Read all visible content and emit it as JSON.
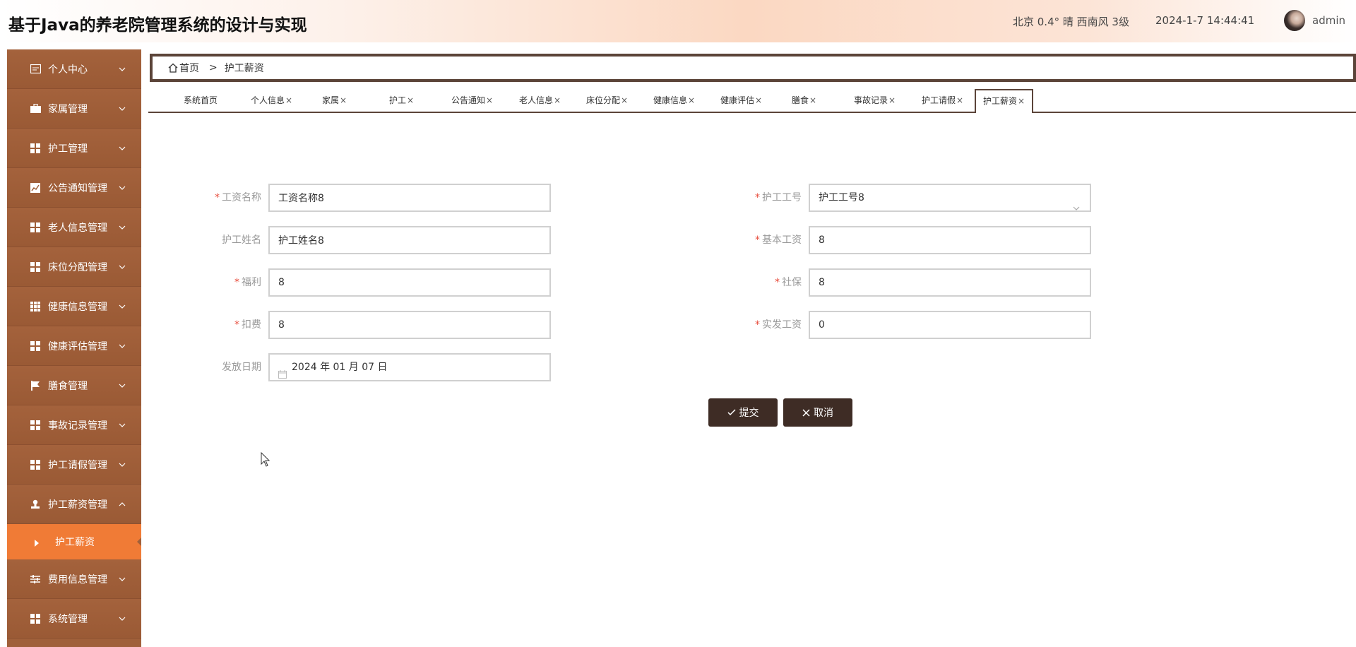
{
  "header": {
    "title": "基于Java的养老院管理系统的设计与实现",
    "weather": "北京  0.4°  晴  西南风  3级",
    "datetime": "2024-1-7 14:44:41",
    "username": "admin"
  },
  "sidebar": {
    "items": [
      {
        "label": "个人中心",
        "icon": "profile-icon"
      },
      {
        "label": "家属管理",
        "icon": "briefcase-icon"
      },
      {
        "label": "护工管理",
        "icon": "grid-icon"
      },
      {
        "label": "公告通知管理",
        "icon": "chart-icon"
      },
      {
        "label": "老人信息管理",
        "icon": "grid-icon"
      },
      {
        "label": "床位分配管理",
        "icon": "grid-icon"
      },
      {
        "label": "健康信息管理",
        "icon": "table-icon"
      },
      {
        "label": "健康评估管理",
        "icon": "grid-icon"
      },
      {
        "label": "膳食管理",
        "icon": "flag-icon"
      },
      {
        "label": "事故记录管理",
        "icon": "grid-icon"
      },
      {
        "label": "护工请假管理",
        "icon": "grid-icon"
      },
      {
        "label": "护工薪资管理",
        "icon": "user-stamp-icon",
        "expanded": true
      },
      {
        "label": "费用信息管理",
        "icon": "sliders-icon"
      },
      {
        "label": "系统管理",
        "icon": "grid-icon"
      }
    ],
    "active_submenu": "护工薪资"
  },
  "breadcrumb": {
    "home": "首页",
    "separator": ">",
    "current": "护工薪资"
  },
  "tabs": [
    {
      "label": "系统首页",
      "closable": false
    },
    {
      "label": "个人信息",
      "closable": true
    },
    {
      "label": "家属",
      "closable": true
    },
    {
      "label": "护工",
      "closable": true
    },
    {
      "label": "公告通知",
      "closable": true
    },
    {
      "label": "老人信息",
      "closable": true
    },
    {
      "label": "床位分配",
      "closable": true
    },
    {
      "label": "健康信息",
      "closable": true
    },
    {
      "label": "健康评估",
      "closable": true
    },
    {
      "label": "膳食",
      "closable": true
    },
    {
      "label": "事故记录",
      "closable": true
    },
    {
      "label": "护工请假",
      "closable": true
    },
    {
      "label": "护工薪资",
      "closable": true,
      "active": true
    }
  ],
  "form": {
    "salary_name": {
      "label": "工资名称",
      "required": true,
      "value": "工资名称8"
    },
    "worker_id": {
      "label": "护工工号",
      "required": true,
      "value": "护工工号8"
    },
    "worker_name": {
      "label": "护工姓名",
      "required": false,
      "value": "护工姓名8"
    },
    "base_salary": {
      "label": "基本工资",
      "required": true,
      "value": "8"
    },
    "welfare": {
      "label": "福利",
      "required": true,
      "value": "8"
    },
    "social_security": {
      "label": "社保",
      "required": true,
      "value": "8"
    },
    "deduction": {
      "label": "扣费",
      "required": true,
      "value": "8"
    },
    "actual_salary": {
      "label": "实发工资",
      "required": true,
      "value": "0"
    },
    "pay_date": {
      "label": "发放日期",
      "required": false,
      "value": "2024 年 01 月 07 日"
    },
    "submit_label": "提交",
    "cancel_label": "取消"
  },
  "colors": {
    "sidebar_bg": "#a0603a",
    "active_submenu_bg": "#f07b36",
    "button_bg": "#3e2c25",
    "required_star": "#e74c3c"
  }
}
